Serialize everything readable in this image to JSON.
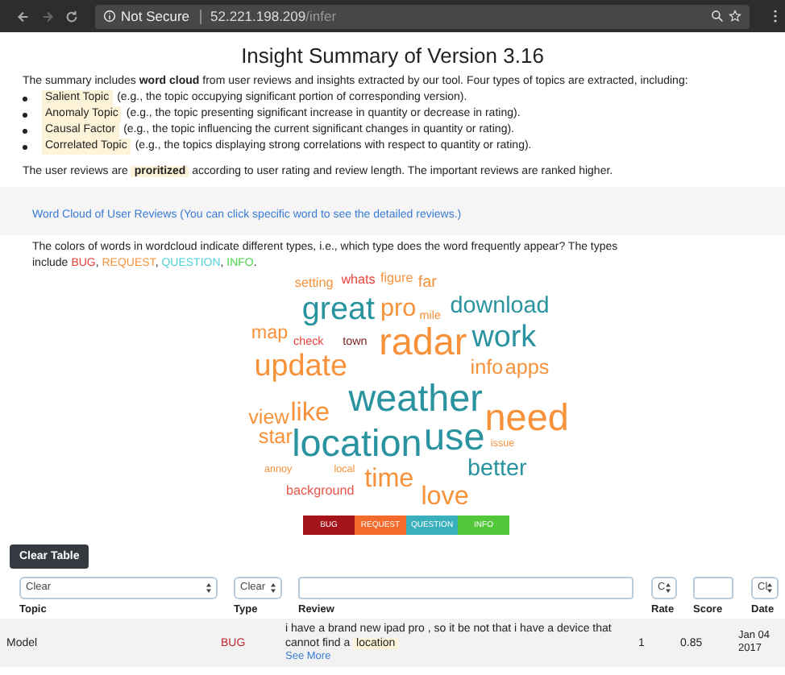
{
  "browser": {
    "security": "Not Secure",
    "host": "52.221.198.209",
    "path": "/infer"
  },
  "title": "Insight Summary of Version 3.16",
  "intro": "The summary includes **word cloud** from user reviews and insights extracted by our tool. Four types of topics are extracted, including:",
  "topic_types": [
    {
      "term": "Salient Topic",
      "desc": "(e.g., the topic occupying significant portion of corresponding version)."
    },
    {
      "term": "Anomaly Topic",
      "desc": "(e.g., the topic presenting significant increase in quantity or decrease in rating)."
    },
    {
      "term": "Causal Factor",
      "desc": "(e.g., the topic influencing the current significant changes in quantity or rating)."
    },
    {
      "term": "Correlated Topic",
      "desc": "(e.g., the topics displaying strong correlations with respect to quantity or rating)."
    }
  ],
  "priority_note": "The user reviews are **proritized** according to user rating and review length. The important reviews are ranked higher.",
  "wordcloud_link": "Word Cloud of User Reviews (You can click specific word to see the detailed reviews.)",
  "colors_note": "The colors of words in wordcloud indicate different types, i.e., which type does the word frequently appear? The types include",
  "types": [
    {
      "label": "BUG",
      "color": "#e8413a",
      "after": ", "
    },
    {
      "label": "REQUEST",
      "color": "#f7923a",
      "after": ", "
    },
    {
      "label": "QUESTION",
      "color": "#4fd0d8",
      "after": ", "
    },
    {
      "label": "INFO",
      "color": "#4cd44c",
      "after": "."
    }
  ],
  "words": [
    {
      "text": "setting",
      "color": "#f7923a"
    },
    {
      "text": "whats",
      "color": "#e8413a"
    },
    {
      "text": "figure",
      "color": "#f7923a"
    },
    {
      "text": "far",
      "color": "#f7923a"
    },
    {
      "text": "great",
      "color": "#2a93a0"
    },
    {
      "text": "pro",
      "color": "#f7923a"
    },
    {
      "text": "mile",
      "color": "#f7923a"
    },
    {
      "text": "download",
      "color": "#2a93a0"
    },
    {
      "text": "map",
      "color": "#f7923a"
    },
    {
      "text": "check",
      "color": "#e8413a"
    },
    {
      "text": "town",
      "color": "#7a1a1a"
    },
    {
      "text": "radar",
      "color": "#f7923a"
    },
    {
      "text": "work",
      "color": "#2a93a0"
    },
    {
      "text": "update",
      "color": "#f7923a"
    },
    {
      "text": "info",
      "color": "#f7923a"
    },
    {
      "text": "apps",
      "color": "#f7923a"
    },
    {
      "text": "weather",
      "color": "#2a93a0"
    },
    {
      "text": "view",
      "color": "#f7923a"
    },
    {
      "text": "like",
      "color": "#f7923a"
    },
    {
      "text": "need",
      "color": "#f7923a"
    },
    {
      "text": "star",
      "color": "#f7923a"
    },
    {
      "text": "location",
      "color": "#2a93a0"
    },
    {
      "text": "use",
      "color": "#2a93a0"
    },
    {
      "text": "issue",
      "color": "#f7923a"
    },
    {
      "text": "annoy",
      "color": "#f7923a"
    },
    {
      "text": "local",
      "color": "#f7923a"
    },
    {
      "text": "time",
      "color": "#f7923a"
    },
    {
      "text": "better",
      "color": "#2a93a0"
    },
    {
      "text": "background",
      "color": "#e8534a"
    },
    {
      "text": "love",
      "color": "#f7923a"
    }
  ],
  "legend": [
    {
      "label": "BUG",
      "color": "#a5141b"
    },
    {
      "label": "REQUEST",
      "color": "#f26a2c"
    },
    {
      "label": "QUESTION",
      "color": "#3ab0bc"
    },
    {
      "label": "INFO",
      "color": "#52c83a"
    }
  ],
  "clear_button": "Clear Table",
  "filters": {
    "topic": "Clear",
    "type": "Clear",
    "rate": "C",
    "date": "Cl"
  },
  "table": {
    "columns": [
      "Topic",
      "Type",
      "Review",
      "Rate",
      "Score",
      "Date"
    ],
    "rows": [
      {
        "topic": "Model",
        "type": "BUG",
        "kind": "bug",
        "review": "i have a brand new ipad pro , so it be not that i have a device that cannot find a",
        "keyword": "location",
        "link": "See More",
        "rate": "1",
        "score": "0.85",
        "date": "Jan 04 2017"
      }
    ]
  }
}
